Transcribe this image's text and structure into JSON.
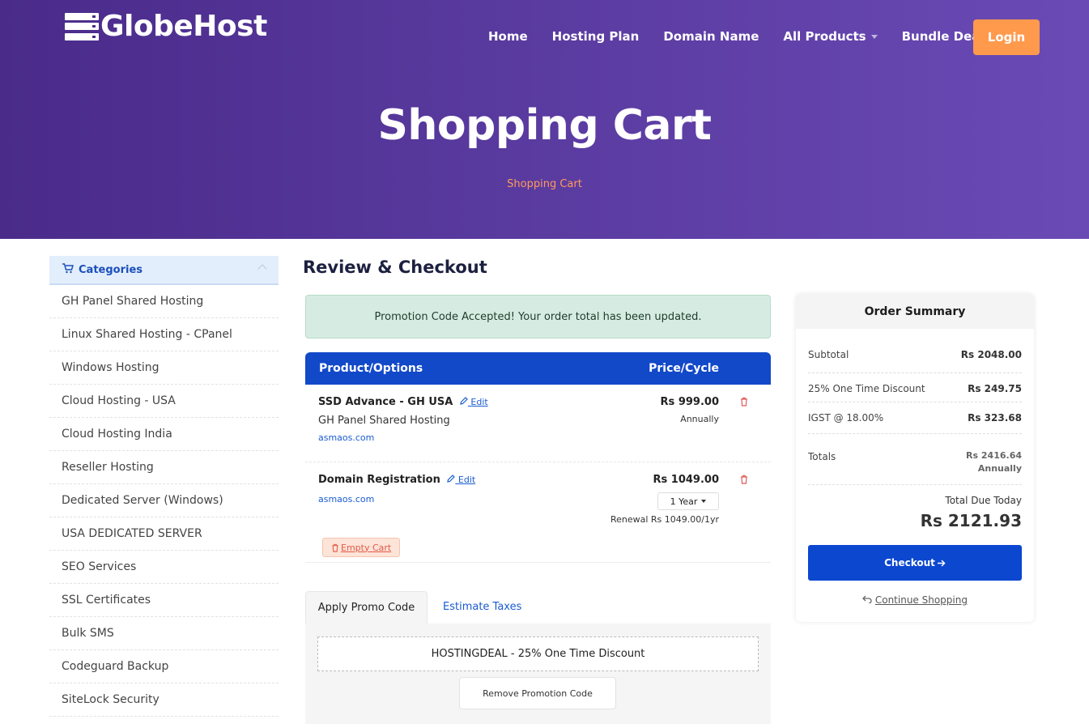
{
  "brand": {
    "name": "GlobeHost"
  },
  "nav": {
    "items": [
      "Home",
      "Hosting Plan",
      "Domain Name",
      "All Products",
      "Bundle Deal"
    ],
    "login": "Login"
  },
  "hero": {
    "title": "Shopping Cart",
    "breadcrumb": "Shopping Cart"
  },
  "sidebar": {
    "heading": "Categories",
    "items": [
      "GH Panel Shared Hosting",
      "Linux Shared Hosting - CPanel",
      "Windows Hosting",
      "Cloud Hosting - USA",
      "Cloud Hosting India",
      "Reseller Hosting",
      "Dedicated Server (Windows)",
      "USA DEDICATED SERVER",
      "SEO Services",
      "SSL Certificates",
      "Bulk SMS",
      "Codeguard Backup",
      "SiteLock Security"
    ]
  },
  "main": {
    "title": "Review & Checkout",
    "alert": "Promotion Code Accepted! Your order total has been updated.",
    "table": {
      "col_product": "Product/Options",
      "col_price": "Price/Cycle",
      "rows": [
        {
          "name": "SSD Advance - GH USA",
          "edit": "Edit",
          "group": "GH Panel Shared Hosting",
          "domain": "asmaos.com",
          "price": "Rs 999.00",
          "cycle": "Annually"
        },
        {
          "name": "Domain Registration",
          "edit": "Edit",
          "domain": "asmaos.com",
          "price": "Rs 1049.00",
          "period": "1 Year",
          "renewal": "Renewal Rs 1049.00/1yr"
        }
      ],
      "empty_cart": "Empty Cart"
    },
    "tabs": {
      "promo": "Apply Promo Code",
      "taxes": "Estimate Taxes",
      "applied_code": "HOSTINGDEAL - 25% One Time Discount",
      "remove": "Remove Promotion Code"
    }
  },
  "summary": {
    "title": "Order Summary",
    "subtotal_label": "Subtotal",
    "subtotal": "Rs 2048.00",
    "discount_label": "25% One Time Discount",
    "discount": "Rs 249.75",
    "tax_label": "IGST @ 18.00%",
    "tax": "Rs 323.68",
    "totals_label": "Totals",
    "totals": "Rs 2416.64",
    "totals_cycle": "Annually",
    "due_label": "Total Due Today",
    "due": "Rs 2121.93",
    "checkout": "Checkout",
    "continue": "Continue Shopping"
  },
  "colors": {
    "primary": "#1249c9",
    "accent": "#ff9a4d",
    "hero_start": "#4a2b8a",
    "hero_end": "#6a4ab5"
  }
}
